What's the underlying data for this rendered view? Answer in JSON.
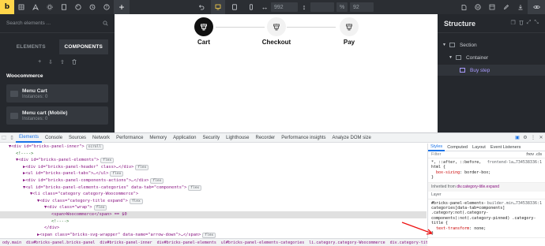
{
  "toolbar": {
    "logo": "b",
    "breakpoint_width": "992",
    "zoom_label": "%",
    "zoom_value": "92"
  },
  "left_panel": {
    "search_placeholder": "Search elements ...",
    "tabs": [
      {
        "label": "ELEMENTS",
        "active": false
      },
      {
        "label": "COMPONENTS",
        "active": true
      }
    ],
    "category": "Woocommerce",
    "components": [
      {
        "name": "Menu Cart",
        "instances": "Instances: 0"
      },
      {
        "name": "Menu cart (Mobile)",
        "instances": "Instances: 0"
      }
    ]
  },
  "canvas": {
    "steps": [
      {
        "label": "Cart",
        "active": true
      },
      {
        "label": "Checkout",
        "active": false
      },
      {
        "label": "Pay",
        "active": false
      }
    ]
  },
  "structure": {
    "title": "Structure",
    "items": [
      {
        "label": "Section",
        "level": 0,
        "selected": false
      },
      {
        "label": "Container",
        "level": 1,
        "selected": false
      },
      {
        "label": "Buy step",
        "level": 2,
        "selected": true
      }
    ]
  },
  "devtools": {
    "tabs": [
      "Elements",
      "Console",
      "Sources",
      "Network",
      "Performance",
      "Memory",
      "Application",
      "Security",
      "Lighthouse",
      "Recorder",
      "Performance insights",
      "Analyze DOM size"
    ],
    "active_tab": "Elements",
    "dom_lines": [
      {
        "indent": 1,
        "html": "▼<div id=\"bricks-panel-inner\">",
        "badge": "scroll"
      },
      {
        "indent": 2,
        "html": "<!---->",
        "badge": ""
      },
      {
        "indent": 2,
        "html": "▼<div id=\"bricks-panel-elements\">",
        "badge": "flex"
      },
      {
        "indent": 3,
        "html": "▶<div id=\"bricks-panel-header\" class>…</div>",
        "badge": "flex"
      },
      {
        "indent": 3,
        "html": "▶<ul id=\"bricks-panel-tabs\">…</ul>",
        "badge": "flex"
      },
      {
        "indent": 3,
        "html": "▶<div id=\"bricks-panel-components-actions\">…</div>",
        "badge": "flex"
      },
      {
        "indent": 3,
        "html": "▼<ul id=\"bricks-panel-elements-categories\" data-tab=\"components\">",
        "badge": "flex"
      },
      {
        "indent": 4,
        "html": "▼<li class=\"category category-Woocommerce\">",
        "badge": ""
      },
      {
        "indent": 5,
        "html": "▼<div class=\"category-title expand\">",
        "badge": "flex"
      },
      {
        "indent": 6,
        "html": "▼<div class=\"wrap\">",
        "badge": "flex"
      },
      {
        "indent": 7,
        "html": "<span>Woocommerce</span> == $0",
        "badge": "",
        "highlight": true
      },
      {
        "indent": 7,
        "html": "<!---->",
        "badge": ""
      },
      {
        "indent": 6,
        "html": "</div>",
        "badge": ""
      },
      {
        "indent": 5,
        "html": "▶<span class=\"bricks-svg-wrapper\" data-name=\"arrow-down\">…</span>",
        "badge": "flex"
      },
      {
        "indent": 5,
        "html": "</div>",
        "badge": ""
      }
    ],
    "breadcrumbs": [
      "ody.main",
      "div#bricks-panel.bricks-panel",
      "div#bricks-panel-inner",
      "div#bricks-panel-elements",
      "ul#bricks-panel-elements-categories",
      "li.category.category-Woocommerce",
      "div.category-title.expand",
      "div.wrap",
      "span"
    ],
    "styles": {
      "tabs": [
        "Styles",
        "Computed",
        "Layout",
        "Event Listeners"
      ],
      "active_tab": "Styles",
      "filter_placeholder": "Filter",
      "filter_tools": ":hov .cls",
      "rule1_selector": "*, ::after, ::before, html {",
      "rule1_source": "frontend-la…734538336:1",
      "rule1_prop": "box-sizing",
      "rule1_value": "border-box;",
      "inherited_prefix": "Inherited from ",
      "inherited_from": "div.category-title.expand",
      "layer": "Layer",
      "rule2_selector": "#bricks-panel-elements-categories[data-tab=components] .category:not(.category-components):not(.category-pinned) .category-title {",
      "rule2_source": "builder.min…734538336:1",
      "rule2_prop": "text-transform",
      "rule2_value": "none;"
    }
  }
}
